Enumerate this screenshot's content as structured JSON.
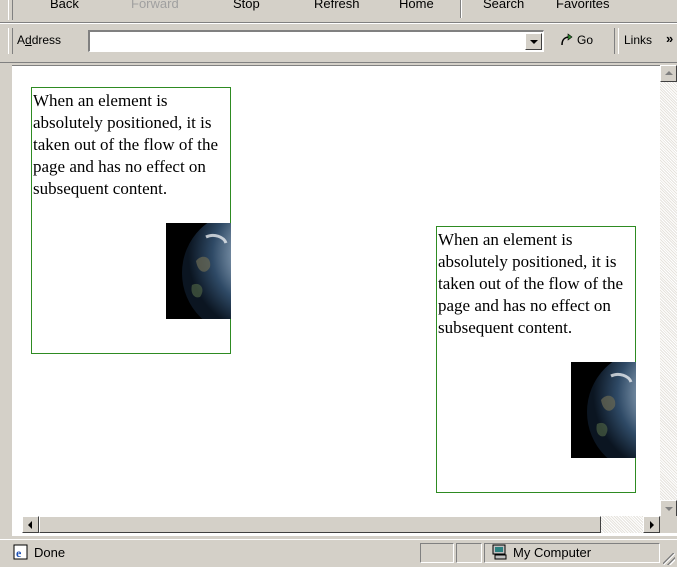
{
  "toolbar": {
    "back": "Back",
    "forward": "Forward",
    "stop": "Stop",
    "refresh": "Refresh",
    "home": "Home",
    "search": "Search",
    "favorites": "Favorites"
  },
  "address_bar": {
    "label_prefix": "A",
    "label_accel": "d",
    "label_suffix": "dress",
    "value": "",
    "go_label": "Go",
    "links_label": "Links",
    "more_glyph": "»"
  },
  "content": {
    "box1_text": "When an element is absolutely positioned, it is taken out of the flow of the page and has no effect on subsequent content.",
    "box2_text": "When an element is absolutely positioned, it is taken out of the flow of the page and has no effect on subsequent content.",
    "image_subject": "earth-image",
    "box_border_color": "#2e8b22"
  },
  "status_bar": {
    "status_text": "Done",
    "zone_text": "My Computer"
  },
  "icons": {
    "go": "go-arrow-icon",
    "page": "ie-page-icon",
    "zone": "computer-icon"
  }
}
